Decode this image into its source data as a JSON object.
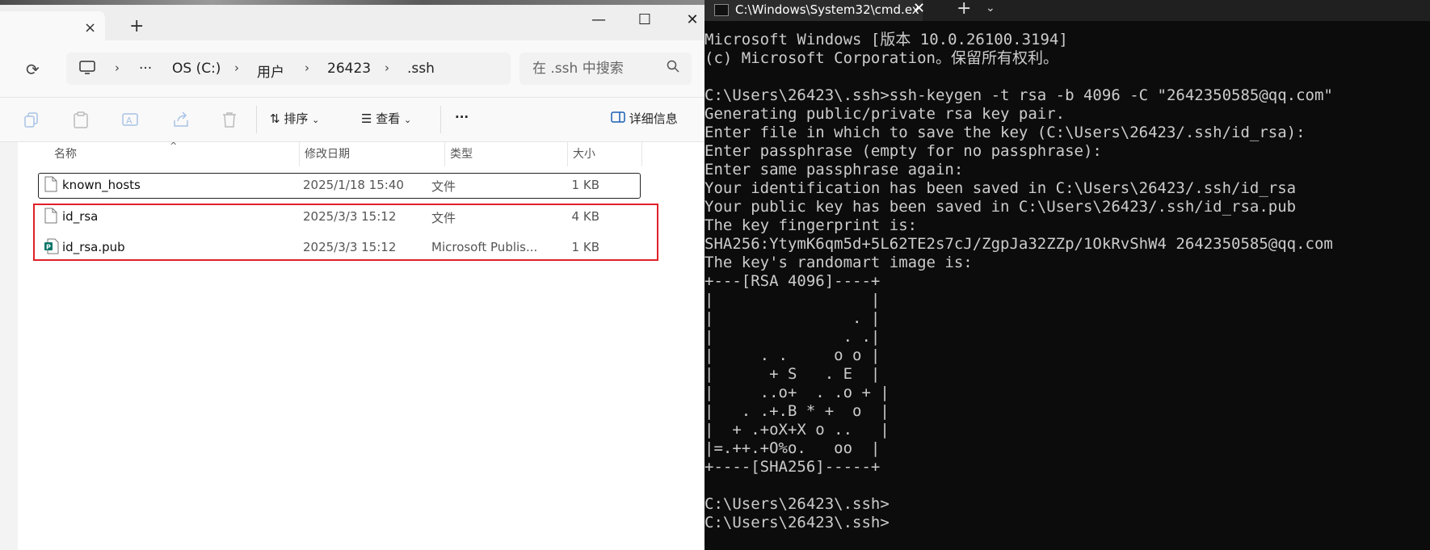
{
  "explorer": {
    "tab_close": "×",
    "tab_new": "+",
    "window_buttons": {
      "minimize": "—",
      "maximize": "☐",
      "close": "✕"
    },
    "breadcrumb": [
      "OS (C:)",
      "用户",
      "26423",
      ".ssh"
    ],
    "breadcrumb_more": "···",
    "search_placeholder": "在 .ssh 中搜索",
    "toolbar": {
      "sort_label": "排序",
      "view_label": "查看",
      "more_label": "···",
      "details_label": "详细信息"
    },
    "columns": {
      "name": "名称",
      "date": "修改日期",
      "type": "类型",
      "size": "大小"
    },
    "files": [
      {
        "name": "known_hosts",
        "date": "2025/1/18 15:40",
        "type": "文件",
        "size": "1 KB"
      },
      {
        "name": "id_rsa",
        "date": "2025/3/3 15:12",
        "type": "文件",
        "size": "4 KB"
      },
      {
        "name": "id_rsa.pub",
        "date": "2025/3/3 15:12",
        "type": "Microsoft Publis...",
        "size": "1 KB"
      }
    ]
  },
  "cmd": {
    "tab_title": "C:\\Windows\\System32\\cmd.ex",
    "tab_close": "✕",
    "new_tab": "+",
    "dropdown": "⌄",
    "lines": [
      "Microsoft Windows [版本 10.0.26100.3194]",
      "(c) Microsoft Corporation。保留所有权利。",
      "",
      "C:\\Users\\26423\\.ssh>ssh-keygen -t rsa -b 4096 -C \"2642350585@qq.com\"",
      "Generating public/private rsa key pair.",
      "Enter file in which to save the key (C:\\Users\\26423/.ssh/id_rsa):",
      "Enter passphrase (empty for no passphrase):",
      "Enter same passphrase again:",
      "Your identification has been saved in C:\\Users\\26423/.ssh/id_rsa",
      "Your public key has been saved in C:\\Users\\26423/.ssh/id_rsa.pub",
      "The key fingerprint is:",
      "SHA256:YtymK6qm5d+5L62TE2s7cJ/ZgpJa32ZZp/1OkRvShW4 2642350585@qq.com",
      "The key's randomart image is:",
      "+---[RSA 4096]----+",
      "|                 |",
      "|               . |",
      "|              . .|",
      "|     . .     o o |",
      "|      + S   . E  |",
      "|     ..o+  . .o + |",
      "|   . .+.B * +  o  |",
      "|  + .+oX+X o ..   |",
      "|=.++.+O%o.   oo  |",
      "+----[SHA256]-----+",
      "",
      "C:\\Users\\26423\\.ssh>",
      "C:\\Users\\26423\\.ssh>"
    ]
  }
}
